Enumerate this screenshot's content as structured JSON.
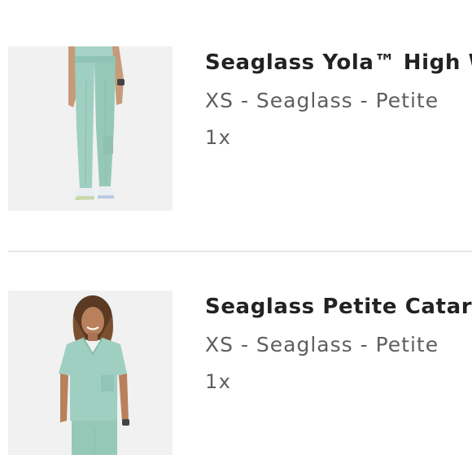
{
  "cart": {
    "items": [
      {
        "title": "Seaglass Yola™ High Waisted Scrub Pants",
        "variant": "XS - Seaglass - Petite",
        "quantity": "1x",
        "image_icon": "scrub-pants-product-image"
      },
      {
        "title": "Seaglass Petite Catarina One-Pocket Scrub Top",
        "variant": "XS - Seaglass - Petite",
        "quantity": "1x",
        "image_icon": "scrub-top-product-image"
      }
    ]
  },
  "colors": {
    "seaglass": "#9fcfc0",
    "title_text": "#222222",
    "secondary_text": "#5e5e5e",
    "divider": "#e6e6e6",
    "image_background": "#f1f1f1"
  }
}
